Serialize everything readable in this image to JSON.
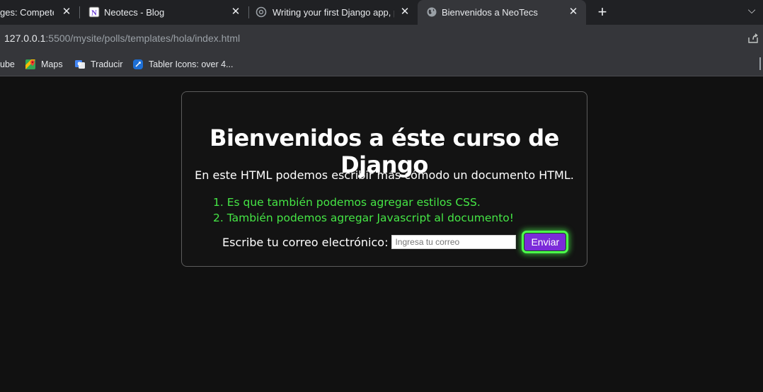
{
  "browser": {
    "tabs": [
      {
        "title": "ges: Compete",
        "icon": "page-icon"
      },
      {
        "title": "Neotecs - Blog",
        "icon": "notion-icon"
      },
      {
        "title": "Writing your first Django app, pa",
        "icon": "loading-icon"
      },
      {
        "title": "Bienvenidos a NeoTecs",
        "icon": "globe-icon",
        "active": true
      }
    ],
    "close_glyph": "✕",
    "new_tab_glyph": "+",
    "tab_list_glyph": "⌵",
    "address": {
      "host": "127.0.0.1",
      "rest": ":5500/mysite/polls/templates/hola/index.html"
    },
    "bookmarks": [
      {
        "label": "ube",
        "icon": "youtube-icon"
      },
      {
        "label": "Maps",
        "icon": "maps-icon"
      },
      {
        "label": "Traducir",
        "icon": "translate-icon"
      },
      {
        "label": "Tabler Icons: over 4...",
        "icon": "tabler-icon"
      }
    ]
  },
  "page": {
    "heading": "Bienvenidos a éste curso de Django",
    "intro": "En este HTML podemos escribir más cómodo un documento HTML.",
    "list": [
      "Es que también podemos agregar estilos CSS.",
      "También podemos agregar Javascript al documento!"
    ],
    "form": {
      "label": "Escribe tu correo electrónico:",
      "placeholder": "Ingresa tu correo",
      "button": "Enviar"
    }
  },
  "colors": {
    "page_bg": "#111111",
    "accent_green": "#45e645",
    "button_purple": "#7b2bd9"
  }
}
